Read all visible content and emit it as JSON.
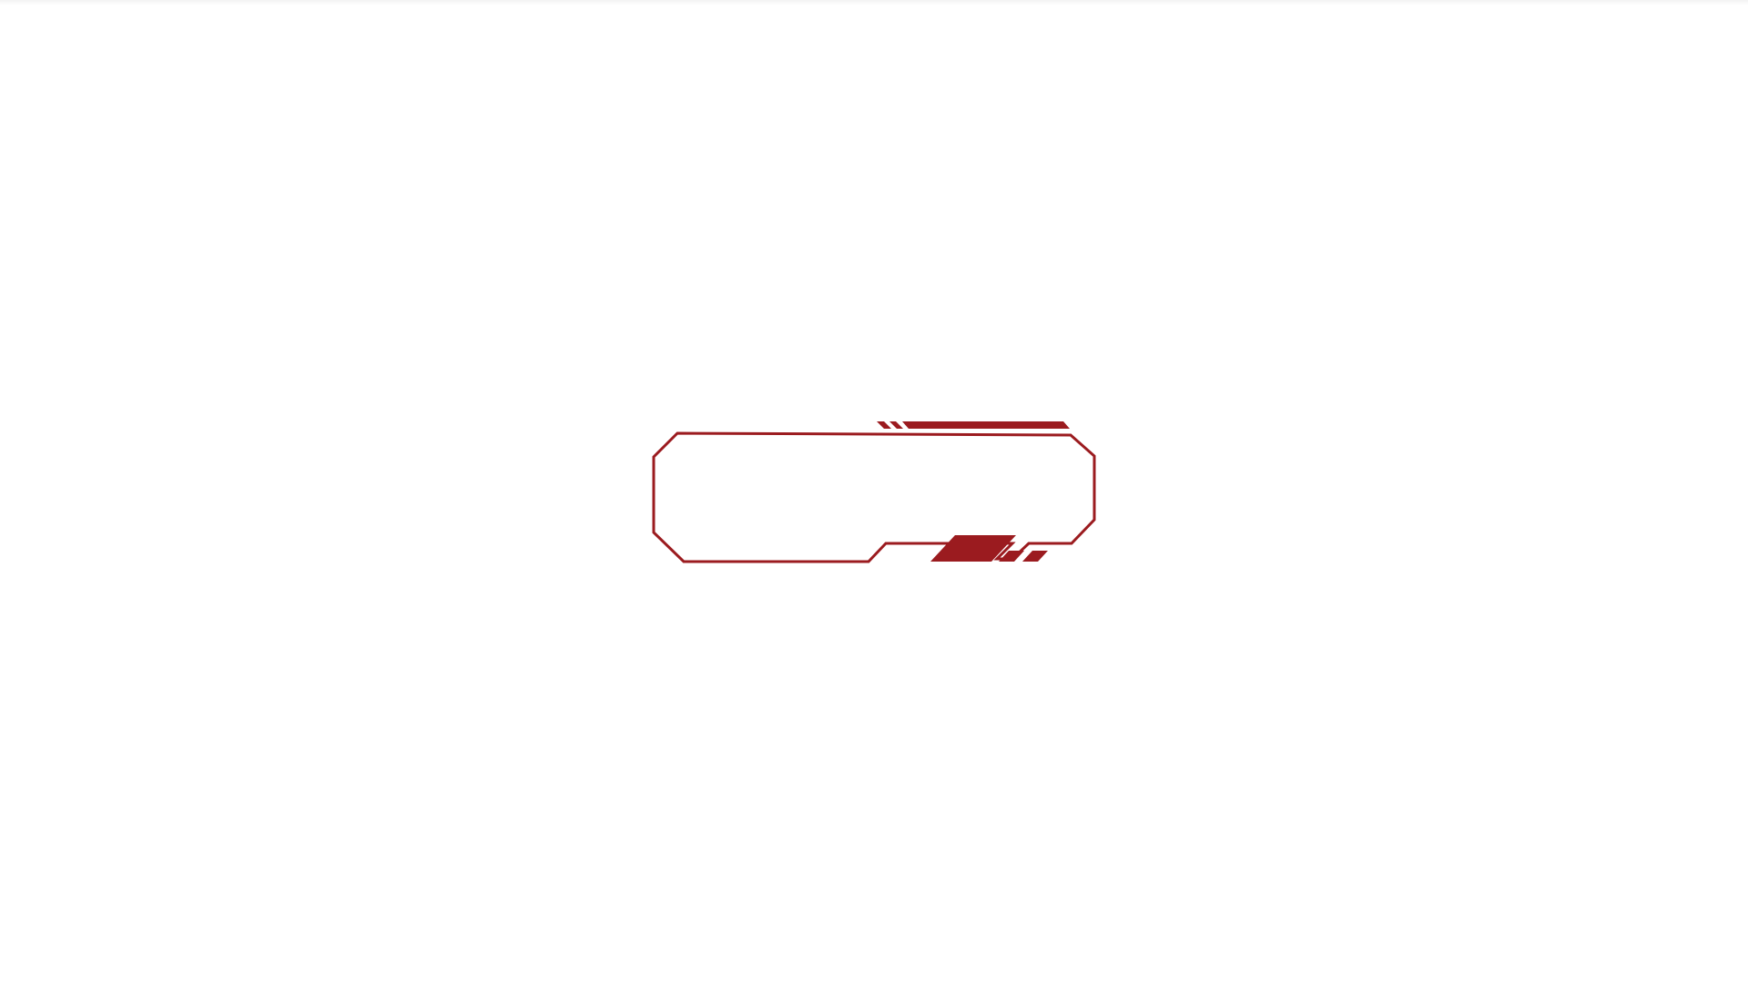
{
  "frame": {
    "accent_color": "#9b1b1f",
    "background_color": "#ffffff",
    "label": ""
  }
}
